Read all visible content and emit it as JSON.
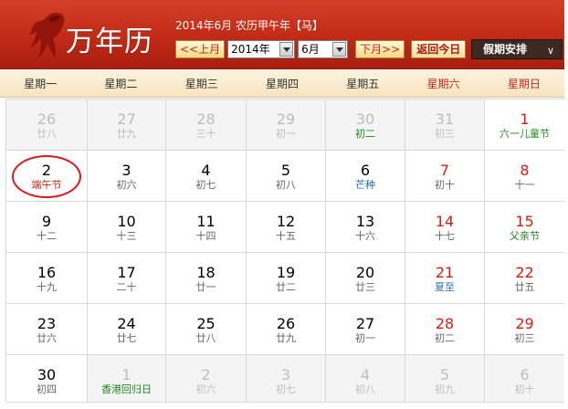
{
  "header": {
    "brand": "万年历",
    "subtitle": "2014年6月 农历甲午年【马】",
    "prev_month": "<<上月",
    "year_value": "2014年",
    "month_value": "6月",
    "next_month": "下月>>",
    "today": "返回今日",
    "holiday": "假期安排",
    "holiday_chevron": "∨"
  },
  "colors": {
    "header_red": "#c12a16",
    "weekend_red": "#d91c0f",
    "festival_green": "#1f8a1f",
    "solar_term_blue": "#1f6eb8",
    "highlight_circle": "#e0141a"
  },
  "weekdays": [
    "星期一",
    "星期二",
    "星期三",
    "星期四",
    "星期五",
    "星期六",
    "星期日"
  ],
  "weeks": [
    [
      {
        "day": "26",
        "lunar": "廿八",
        "other": true
      },
      {
        "day": "27",
        "lunar": "廿九",
        "other": true
      },
      {
        "day": "28",
        "lunar": "三十",
        "other": true
      },
      {
        "day": "29",
        "lunar": "初一",
        "other": true
      },
      {
        "day": "30",
        "lunar": "初二",
        "other": true,
        "fest": "green"
      },
      {
        "day": "31",
        "lunar": "初三",
        "other": true
      },
      {
        "day": "1",
        "lunar": "六一儿童节",
        "fest": "green"
      }
    ],
    [
      {
        "day": "2",
        "lunar": "端午节",
        "fest": "red",
        "circled": true
      },
      {
        "day": "3",
        "lunar": "初六"
      },
      {
        "day": "4",
        "lunar": "初七"
      },
      {
        "day": "5",
        "lunar": "初八"
      },
      {
        "day": "6",
        "lunar": "芒种",
        "fest": "blue"
      },
      {
        "day": "7",
        "lunar": "初十"
      },
      {
        "day": "8",
        "lunar": "十一"
      }
    ],
    [
      {
        "day": "9",
        "lunar": "十二"
      },
      {
        "day": "10",
        "lunar": "十三"
      },
      {
        "day": "11",
        "lunar": "十四"
      },
      {
        "day": "12",
        "lunar": "十五"
      },
      {
        "day": "13",
        "lunar": "十六"
      },
      {
        "day": "14",
        "lunar": "十七"
      },
      {
        "day": "15",
        "lunar": "父亲节",
        "fest": "green"
      }
    ],
    [
      {
        "day": "16",
        "lunar": "十九"
      },
      {
        "day": "17",
        "lunar": "二十"
      },
      {
        "day": "18",
        "lunar": "廿一"
      },
      {
        "day": "19",
        "lunar": "廿二"
      },
      {
        "day": "20",
        "lunar": "廿三"
      },
      {
        "day": "21",
        "lunar": "夏至",
        "fest": "blue"
      },
      {
        "day": "22",
        "lunar": "廿五"
      }
    ],
    [
      {
        "day": "23",
        "lunar": "廿六"
      },
      {
        "day": "24",
        "lunar": "廿七"
      },
      {
        "day": "25",
        "lunar": "廿八"
      },
      {
        "day": "26",
        "lunar": "廿九"
      },
      {
        "day": "27",
        "lunar": "初一"
      },
      {
        "day": "28",
        "lunar": "初二"
      },
      {
        "day": "29",
        "lunar": "初三"
      }
    ],
    [
      {
        "day": "30",
        "lunar": "初四"
      },
      {
        "day": "1",
        "lunar": "香港回归日",
        "other": true,
        "fest": "green"
      },
      {
        "day": "2",
        "lunar": "初六",
        "other": true
      },
      {
        "day": "3",
        "lunar": "初七",
        "other": true
      },
      {
        "day": "4",
        "lunar": "初八",
        "other": true
      },
      {
        "day": "5",
        "lunar": "初九",
        "other": true
      },
      {
        "day": "6",
        "lunar": "初十",
        "other": true
      }
    ]
  ]
}
